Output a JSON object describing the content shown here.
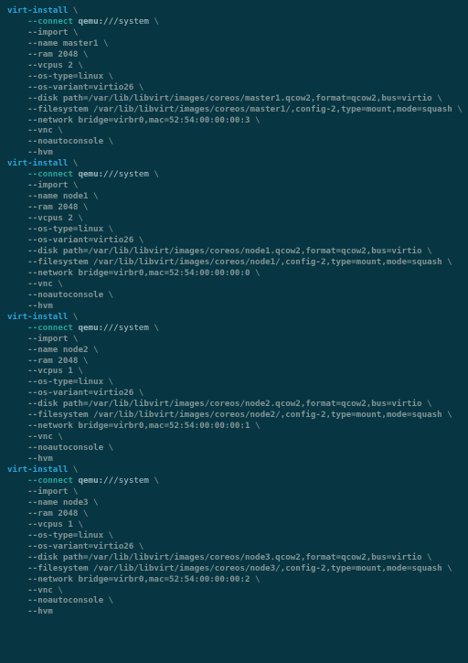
{
  "code": {
    "blocks": [
      {
        "cmd": "virt-install",
        "connect": {
          "opt": "--connect",
          "proto": "qemu:",
          "path": "///system"
        },
        "args": [
          "--import",
          "--name master1",
          "--ram 2048",
          "--vcpus 2",
          "--os-type=linux",
          "--os-variant=virtio26",
          "--disk path=/var/lib/libvirt/images/coreos/master1.qcow2,format=qcow2,bus=virtio",
          "--filesystem /var/lib/libvirt/images/coreos/master1/,config-2,type=mount,mode=squash",
          "--network bridge=virbr0,mac=52:54:00:00:00:3",
          "--vnc",
          "--noautoconsole",
          "--hvm"
        ]
      },
      {
        "cmd": "virt-install",
        "connect": {
          "opt": "--connect",
          "proto": "qemu:",
          "path": "///system"
        },
        "args": [
          "--import",
          "--name node1",
          "--ram 2048",
          "--vcpus 2",
          "--os-type=linux",
          "--os-variant=virtio26",
          "--disk path=/var/lib/libvirt/images/coreos/node1.qcow2,format=qcow2,bus=virtio",
          "--filesystem /var/lib/libvirt/images/coreos/node1/,config-2,type=mount,mode=squash",
          "--network bridge=virbr0,mac=52:54:00:00:00:0",
          "--vnc",
          "--noautoconsole",
          "--hvm"
        ]
      },
      {
        "cmd": "virt-install",
        "connect": {
          "opt": "--connect",
          "proto": "qemu:",
          "path": "///system"
        },
        "args": [
          "--import",
          "--name node2",
          "--ram 2048",
          "--vcpus 1",
          "--os-type=linux",
          "--os-variant=virtio26",
          "--disk path=/var/lib/libvirt/images/coreos/node2.qcow2,format=qcow2,bus=virtio",
          "--filesystem /var/lib/libvirt/images/coreos/node2/,config-2,type=mount,mode=squash",
          "--network bridge=virbr0,mac=52:54:00:00:00:1",
          "--vnc",
          "--noautoconsole",
          "--hvm"
        ]
      },
      {
        "cmd": "virt-install",
        "connect": {
          "opt": "--connect",
          "proto": "qemu:",
          "path": "///system"
        },
        "args": [
          "--import",
          "--name node3",
          "--ram 2048",
          "--vcpus 1",
          "--os-type=linux",
          "--os-variant=virtio26",
          "--disk path=/var/lib/libvirt/images/coreos/node3.qcow2,format=qcow2,bus=virtio",
          "--filesystem /var/lib/libvirt/images/coreos/node3/,config-2,type=mount,mode=squash",
          "--network bridge=virbr0,mac=52:54:00:00:00:2",
          "--vnc",
          "--noautoconsole",
          "--hvm"
        ]
      }
    ],
    "cont": " \\",
    "indent": "    "
  }
}
